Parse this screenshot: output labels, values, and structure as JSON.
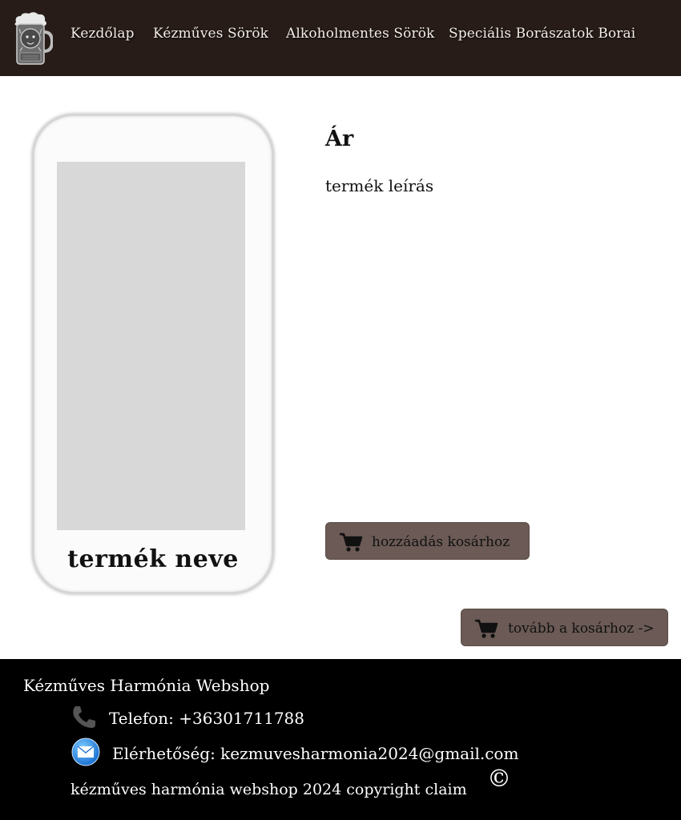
{
  "nav": {
    "items": [
      {
        "label": "Kezdőlap"
      },
      {
        "label": "Kézműves Sörök"
      },
      {
        "label": "Alkoholmentes Sörök"
      },
      {
        "label": "Speciális Borászatok Borai"
      }
    ]
  },
  "product": {
    "name": "termék neve",
    "price": "Ár",
    "description": "termék leírás",
    "add_to_cart_label": "hozzáadás kosárhoz",
    "go_to_cart_label": "tovább a kosárhoz ->"
  },
  "footer": {
    "title": "Kézműves Harmónia Webshop",
    "phone": "Telefon: +36301711788",
    "email": "Elérhetőség: kezmuvesharmonia2024@gmail.com",
    "copyright": "kézműves harmónia webshop 2024 copyright claim",
    "copyright_symbol": "©"
  },
  "colors": {
    "header_bg": "#271c18",
    "button_bg": "#6b5a55",
    "footer_bg": "#000000",
    "image_placeholder": "#d8d8d8"
  },
  "icons": {
    "logo": "beer-mug-lion-logo",
    "cart": "cart-icon",
    "phone": "phone-icon",
    "mail": "mail-icon"
  }
}
